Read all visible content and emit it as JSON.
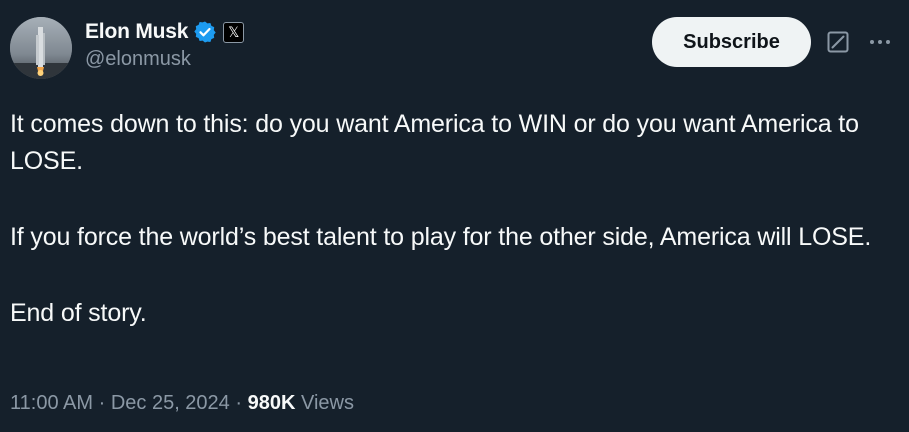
{
  "author": {
    "display_name": "Elon Musk",
    "handle": "@elonmusk",
    "verified_icon": "verified-badge-icon",
    "affiliation_icon": "x-logo-icon",
    "affiliation_glyph": "𝕏"
  },
  "header": {
    "subscribe_label": "Subscribe",
    "grok_icon": "grok-icon",
    "more_icon": "more-icon"
  },
  "tweet": {
    "paragraphs": [
      "It comes down to this: do you want America to WIN or do you want America to LOSE.",
      "If you force the world’s best talent to play for the other side, America will LOSE.",
      "End of story."
    ]
  },
  "meta": {
    "time": "11:00 AM",
    "separator": "·",
    "date": "Dec 25, 2024",
    "views_count": "980K",
    "views_label": "Views"
  },
  "colors": {
    "background": "#15202b",
    "text": "#f7f9f9",
    "muted": "#8b98a5",
    "verified": "#1d9bf0",
    "button": "#eff3f4"
  }
}
